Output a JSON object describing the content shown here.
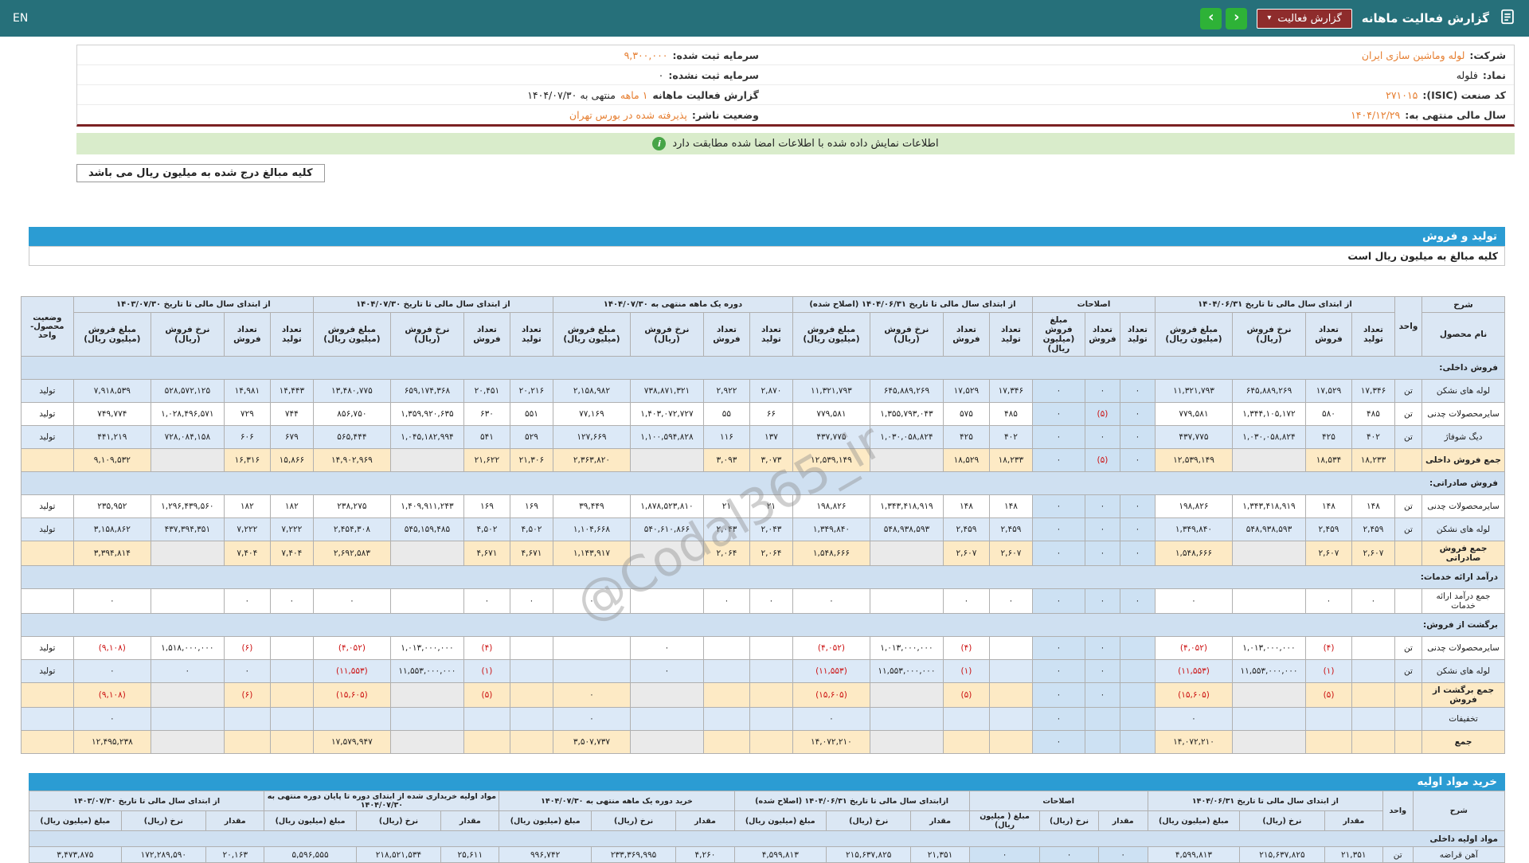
{
  "top_bar": {
    "title": "گزارش فعالیت ماهانه",
    "dropdown_label": "گزارش فعالیت",
    "caret": "▾",
    "prev": "‹",
    "next": "›",
    "lang": "EN"
  },
  "company_info": {
    "rows": [
      {
        "right": {
          "label": "شرکت:",
          "value": "لوله وماشین سازی ایران",
          "highlight": true
        },
        "left": {
          "label": "سرمایه ثبت شده:",
          "value": "۹,۳۰۰,۰۰۰",
          "highlight": true
        }
      },
      {
        "right": {
          "label": "نماد:",
          "value": "فلوله",
          "highlight": false
        },
        "left": {
          "label": "سرمایه ثبت نشده:",
          "value": "۰",
          "highlight": false
        }
      },
      {
        "right": {
          "label": "کد صنعت (ISIC):",
          "value": "۲۷۱۰۱۵",
          "highlight": true
        },
        "left": {
          "label": "گزارش فعالیت ماهانه",
          "value_hl": "۱ ماهه",
          "value": "منتهی به ۱۴۰۴/۰۷/۳۰",
          "highlight": false
        }
      },
      {
        "right": {
          "label": "سال مالی منتهی به:",
          "value": "۱۴۰۴/۱۲/۲۹",
          "highlight": true
        },
        "left": {
          "label": "وضعیت ناشر:",
          "value": "پذیرفته شده در بورس تهران",
          "highlight": true
        }
      }
    ]
  },
  "notices": {
    "signed": "اطلاعات نمایش داده شده با اطلاعات امضا شده مطابقت دارد",
    "info_icon": "i",
    "amounts": "کلیه مبالغ درج شده به میلیون ریال می باشد"
  },
  "watermark": "@Codal365_ir",
  "colors": {
    "header_teal": "#26707a",
    "accent_red": "#8e2c2c",
    "nav_green": "#2eb237",
    "accent_orange": "#e67e30",
    "section_blue": "#2b9cd3"
  },
  "production_sales": {
    "title": "تولید و فروش",
    "subtitle": "کلیه مبالغ به میلیون ریال است",
    "desc_header": "شرح",
    "name_header": "نام محصول",
    "unit_header": "واحد",
    "status_header": "وضعیت محصول-واحد",
    "groups": [
      {
        "label": "از ابتدای سال مالی تا تاریخ ۱۴۰۴/۰۶/۳۱",
        "cols": [
          "تعداد تولید",
          "تعداد فروش",
          "نرخ فروش (ریال)",
          "مبلغ فروش (میلیون ریال)"
        ]
      },
      {
        "label": "اصلاحات",
        "cols": [
          "تعداد تولید",
          "تعداد فروش",
          "مبلغ فروش (میلیون ریال)"
        ]
      },
      {
        "label": "از ابتدای سال مالی تا تاریخ ۱۴۰۴/۰۶/۳۱ (اصلاح شده)",
        "cols": [
          "تعداد تولید",
          "تعداد فروش",
          "نرخ فروش (ریال)",
          "مبلغ فروش (میلیون ریال)"
        ]
      },
      {
        "label": "دوره یک ماهه منتهی به ۱۴۰۴/۰۷/۳۰",
        "cols": [
          "تعداد تولید",
          "تعداد فروش",
          "نرخ فروش (ریال)",
          "مبلغ فروش (میلیون ریال)"
        ]
      },
      {
        "label": "از ابتدای سال مالی تا تاریخ ۱۴۰۴/۰۷/۳۰",
        "cols": [
          "تعداد تولید",
          "تعداد فروش",
          "نرخ فروش (ریال)",
          "مبلغ فروش (میلیون ریال)"
        ]
      },
      {
        "label": "از ابتدای سال مالی تا تاریخ ۱۴۰۳/۰۷/۳۰",
        "cols": [
          "تعداد تولید",
          "تعداد فروش",
          "نرخ فروش (ریال)",
          "مبلغ فروش (میلیون ریال)"
        ]
      }
    ],
    "rows": [
      {
        "type": "section",
        "name": "فروش داخلی:"
      },
      {
        "type": "data",
        "shade": "blue",
        "name": "لوله های نشکن",
        "unit": "تن",
        "status": "تولید",
        "cells": [
          "۱۷,۳۴۶",
          "۱۷,۵۲۹",
          "۶۴۵,۸۸۹,۲۶۹",
          "۱۱,۳۲۱,۷۹۳",
          "۰",
          "۰",
          "۰",
          "۱۷,۳۴۶",
          "۱۷,۵۲۹",
          "۶۴۵,۸۸۹,۲۶۹",
          "۱۱,۳۲۱,۷۹۳",
          "۲,۸۷۰",
          "۲,۹۲۲",
          "۷۳۸,۸۷۱,۳۲۱",
          "۲,۱۵۸,۹۸۲",
          "۲۰,۲۱۶",
          "۲۰,۴۵۱",
          "۶۵۹,۱۷۴,۳۶۸",
          "۱۳,۴۸۰,۷۷۵",
          "۱۴,۴۴۳",
          "۱۴,۹۸۱",
          "۵۲۸,۵۷۲,۱۲۵",
          "۷,۹۱۸,۵۳۹"
        ]
      },
      {
        "type": "data",
        "shade": "white",
        "name": "سایرمحصولات چدنی",
        "unit": "تن",
        "status": "تولید",
        "cells": [
          "۴۸۵",
          "۵۸۰",
          "۱,۳۴۴,۱۰۵,۱۷۲",
          "۷۷۹,۵۸۱",
          "۰",
          "(۵)",
          "۰",
          "۴۸۵",
          "۵۷۵",
          "۱,۳۵۵,۷۹۳,۰۴۳",
          "۷۷۹,۵۸۱",
          "۶۶",
          "۵۵",
          "۱,۴۰۳,۰۷۲,۷۲۷",
          "۷۷,۱۶۹",
          "۵۵۱",
          "۶۳۰",
          "۱,۳۵۹,۹۲۰,۶۳۵",
          "۸۵۶,۷۵۰",
          "۷۴۴",
          "۷۲۹",
          "۱,۰۲۸,۴۹۶,۵۷۱",
          "۷۴۹,۷۷۴"
        ]
      },
      {
        "type": "data",
        "shade": "blue",
        "name": "دیگ شوفاژ",
        "unit": "تن",
        "status": "تولید",
        "cells": [
          "۴۰۲",
          "۴۲۵",
          "۱,۰۳۰,۰۵۸,۸۲۴",
          "۴۳۷,۷۷۵",
          "۰",
          "۰",
          "۰",
          "۴۰۲",
          "۴۲۵",
          "۱,۰۳۰,۰۵۸,۸۲۴",
          "۴۳۷,۷۷۵",
          "۱۳۷",
          "۱۱۶",
          "۱,۱۰۰,۵۹۴,۸۲۸",
          "۱۲۷,۶۶۹",
          "۵۲۹",
          "۵۴۱",
          "۱,۰۴۵,۱۸۲,۹۹۴",
          "۵۶۵,۴۴۴",
          "۶۷۹",
          "۶۰۶",
          "۷۲۸,۰۸۴,۱۵۸",
          "۴۴۱,۲۱۹"
        ]
      },
      {
        "type": "data",
        "shade": "total",
        "name": "جمع فروش داخلی",
        "unit": "",
        "status": "",
        "cells": [
          "۱۸,۲۳۳",
          "۱۸,۵۳۴",
          "",
          "۱۲,۵۳۹,۱۴۹",
          "۰",
          "(۵)",
          "۰",
          "۱۸,۲۳۳",
          "۱۸,۵۲۹",
          "",
          "۱۲,۵۳۹,۱۴۹",
          "۳,۰۷۳",
          "۳,۰۹۳",
          "",
          "۲,۳۶۳,۸۲۰",
          "۲۱,۳۰۶",
          "۲۱,۶۲۲",
          "",
          "۱۴,۹۰۲,۹۶۹",
          "۱۵,۸۶۶",
          "۱۶,۳۱۶",
          "",
          "۹,۱۰۹,۵۳۲"
        ]
      },
      {
        "type": "section",
        "name": "فروش صادراتی:"
      },
      {
        "type": "data",
        "shade": "white",
        "name": "سایرمحصولات چدنی",
        "unit": "تن",
        "status": "تولید",
        "cells": [
          "۱۴۸",
          "۱۴۸",
          "۱,۳۴۳,۴۱۸,۹۱۹",
          "۱۹۸,۸۲۶",
          "۰",
          "۰",
          "۰",
          "۱۴۸",
          "۱۴۸",
          "۱,۳۴۳,۴۱۸,۹۱۹",
          "۱۹۸,۸۲۶",
          "۲۱",
          "۲۱",
          "۱,۸۷۸,۵۲۳,۸۱۰",
          "۳۹,۴۴۹",
          "۱۶۹",
          "۱۶۹",
          "۱,۴۰۹,۹۱۱,۲۴۳",
          "۲۳۸,۲۷۵",
          "۱۸۲",
          "۱۸۲",
          "۱,۲۹۶,۴۳۹,۵۶۰",
          "۲۳۵,۹۵۲"
        ]
      },
      {
        "type": "data",
        "shade": "blue",
        "name": "لوله های نشکن",
        "unit": "تن",
        "status": "تولید",
        "cells": [
          "۲,۴۵۹",
          "۲,۴۵۹",
          "۵۴۸,۹۳۸,۵۹۳",
          "۱,۳۴۹,۸۴۰",
          "۰",
          "۰",
          "۰",
          "۲,۴۵۹",
          "۲,۴۵۹",
          "۵۴۸,۹۳۸,۵۹۳",
          "۱,۳۴۹,۸۴۰",
          "۲,۰۴۳",
          "۲,۰۴۳",
          "۵۴۰,۶۱۰,۸۶۶",
          "۱,۱۰۴,۶۶۸",
          "۴,۵۰۲",
          "۴,۵۰۲",
          "۵۴۵,۱۵۹,۴۸۵",
          "۲,۴۵۴,۳۰۸",
          "۷,۲۲۲",
          "۷,۲۲۲",
          "۴۳۷,۳۹۴,۳۵۱",
          "۳,۱۵۸,۸۶۲"
        ]
      },
      {
        "type": "data",
        "shade": "total",
        "name": "جمع فروش صادراتی",
        "unit": "",
        "status": "",
        "cells": [
          "۲,۶۰۷",
          "۲,۶۰۷",
          "",
          "۱,۵۴۸,۶۶۶",
          "۰",
          "۰",
          "۰",
          "۲,۶۰۷",
          "۲,۶۰۷",
          "",
          "۱,۵۴۸,۶۶۶",
          "۲,۰۶۴",
          "۲,۰۶۴",
          "",
          "۱,۱۴۳,۹۱۷",
          "۴,۶۷۱",
          "۴,۶۷۱",
          "",
          "۲,۶۹۲,۵۸۳",
          "۷,۴۰۴",
          "۷,۴۰۴",
          "",
          "۳,۳۹۴,۸۱۴"
        ]
      },
      {
        "type": "section",
        "name": "درآمد ارائه خدمات:"
      },
      {
        "type": "data",
        "shade": "white",
        "name": "جمع درآمد ارائه خدمات",
        "unit": "",
        "status": "",
        "cells": [
          "۰",
          "۰",
          "",
          "۰",
          "۰",
          "۰",
          "۰",
          "۰",
          "۰",
          "",
          "۰",
          "۰",
          "۰",
          "",
          "۰",
          "۰",
          "۰",
          "",
          "۰",
          "۰",
          "۰",
          "",
          "۰"
        ]
      },
      {
        "type": "section",
        "name": "برگشت از فروش:"
      },
      {
        "type": "data",
        "shade": "white",
        "name": "سایرمحصولات چدنی",
        "unit": "تن",
        "status": "تولید",
        "cells": [
          "",
          "(۴)",
          "۱,۰۱۳,۰۰۰,۰۰۰",
          "(۴,۰۵۲)",
          "",
          "۰",
          "۰",
          "",
          "(۴)",
          "۱,۰۱۳,۰۰۰,۰۰۰",
          "(۴,۰۵۲)",
          "",
          "",
          "۰",
          "",
          "",
          "(۴)",
          "۱,۰۱۳,۰۰۰,۰۰۰",
          "(۴,۰۵۲)",
          "",
          "(۶)",
          "۱,۵۱۸,۰۰۰,۰۰۰",
          "(۹,۱۰۸)"
        ]
      },
      {
        "type": "data",
        "shade": "blue",
        "name": "لوله های نشکن",
        "unit": "تن",
        "status": "تولید",
        "cells": [
          "",
          "(۱)",
          "۱۱,۵۵۳,۰۰۰,۰۰۰",
          "(۱۱,۵۵۳)",
          "",
          "۰",
          "۰",
          "",
          "(۱)",
          "۱۱,۵۵۳,۰۰۰,۰۰۰",
          "(۱۱,۵۵۳)",
          "",
          "",
          "۰",
          "",
          "",
          "(۱)",
          "۱۱,۵۵۳,۰۰۰,۰۰۰",
          "(۱۱,۵۵۳)",
          "",
          "۰",
          "۰",
          "۰"
        ]
      },
      {
        "type": "data",
        "shade": "total",
        "name": "جمع برگشت از فروش",
        "unit": "",
        "status": "",
        "cells": [
          "",
          "(۵)",
          "",
          "(۱۵,۶۰۵)",
          "",
          "۰",
          "۰",
          "",
          "(۵)",
          "",
          "(۱۵,۶۰۵)",
          "",
          "",
          "",
          "۰",
          "",
          "(۵)",
          "",
          "(۱۵,۶۰۵)",
          "",
          "(۶)",
          "",
          "(۹,۱۰۸)"
        ]
      },
      {
        "type": "data",
        "shade": "blue",
        "name": "تخفیفات",
        "unit": "",
        "status": "",
        "cells": [
          "",
          "",
          "",
          "۰",
          "",
          "",
          "۰",
          "",
          "",
          "",
          "۰",
          "",
          "",
          "",
          "۰",
          "",
          "",
          "",
          "",
          "",
          "",
          "",
          "۰"
        ]
      },
      {
        "type": "data",
        "shade": "total",
        "name": "جمع",
        "unit": "",
        "status": "",
        "cells": [
          "",
          "",
          "",
          "۱۴,۰۷۲,۲۱۰",
          "",
          "",
          "۰",
          "",
          "",
          "",
          "۱۴,۰۷۲,۲۱۰",
          "",
          "",
          "",
          "۳,۵۰۷,۷۳۷",
          "",
          "",
          "",
          "۱۷,۵۷۹,۹۴۷",
          "",
          "",
          "",
          "۱۲,۴۹۵,۲۳۸"
        ]
      }
    ]
  },
  "raw_materials": {
    "title": "خرید مواد اولیه",
    "desc_header": "شرح",
    "unit_header": "واحد",
    "groups": [
      {
        "label": "از ابتدای سال مالی تا تاریخ ۱۴۰۴/۰۶/۳۱",
        "cols": [
          "مقدار",
          "نرخ (ریال)",
          "مبلغ (میلیون ریال)"
        ]
      },
      {
        "label": "اصلاحات",
        "cols": [
          "مقدار",
          "نرخ (ریال)",
          "مبلغ ( میلیون ریال)"
        ]
      },
      {
        "label": "ازابتدای سال مالی تا تاریخ ۱۴۰۴/۰۶/۳۱ (اصلاح شده)",
        "cols": [
          "مقدار",
          "نرخ (ریال)",
          "مبلغ (میلیون ریال)"
        ]
      },
      {
        "label": "خرید دوره یک ماهه منتهی به ۱۴۰۴/۰۷/۳۰",
        "cols": [
          "مقدار",
          "نرخ (ریال)",
          "مبلغ (میلیون ریال)"
        ]
      },
      {
        "label": "مواد اولیه خریداری شده از ابتدای دوره تا پایان دوره منتهی به ۱۴۰۴/۰۷/۳۰",
        "cols": [
          "مقدار",
          "نرخ (ریال)",
          "مبلغ (میلیون ریال)"
        ]
      },
      {
        "label": "از ابتدای سال مالی تا تاریخ ۱۴۰۳/۰۷/۳۰",
        "cols": [
          "مقدار",
          "نرخ (ریال)",
          "مبلغ (میلیون ریال)"
        ]
      }
    ],
    "rows": [
      {
        "type": "section",
        "name": "مواد اولیه داخلی"
      },
      {
        "type": "data",
        "shade": "blue",
        "name": "آهن قراضه",
        "unit": "تن",
        "status": "",
        "cells": [
          "۲۱,۳۵۱",
          "۲۱۵,۶۳۷,۸۲۵",
          "۴,۵۹۹,۸۱۳",
          "۰",
          "۰",
          "۰",
          "۲۱,۳۵۱",
          "۲۱۵,۶۳۷,۸۲۵",
          "۴,۵۹۹,۸۱۳",
          "۴,۲۶۰",
          "۲۳۳,۳۶۹,۹۹۵",
          "۹۹۶,۷۴۲",
          "۲۵,۶۱۱",
          "۲۱۸,۵۲۱,۵۳۴",
          "۵,۵۹۶,۵۵۵",
          "۲۰,۱۶۳",
          "۱۷۲,۲۸۹,۵۹۰",
          "۳,۴۷۳,۸۷۵"
        ]
      }
    ]
  }
}
